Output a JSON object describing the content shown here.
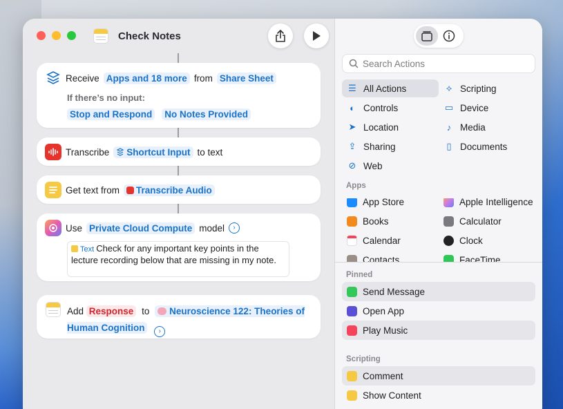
{
  "window": {
    "title": "Check Notes"
  },
  "editor": {
    "receive": {
      "verb": "Receive",
      "types": "Apps and 18 more",
      "from_word": "from",
      "source": "Share Sheet",
      "no_input_label": "If there’s no input:",
      "stop_token": "Stop and Respond",
      "no_notes_token": "No Notes Provided"
    },
    "transcribe": {
      "verb": "Transcribe",
      "input": "Shortcut Input",
      "suffix": "to text"
    },
    "get_text": {
      "verb": "Get text from",
      "input": "Transcribe Audio"
    },
    "use_model": {
      "verb": "Use",
      "model": "Private Cloud Compute",
      "suffix": "model",
      "text_tag": "Text",
      "prompt": "Check for any important key points in the lecture recording below that are missing in my note."
    },
    "add": {
      "verb": "Add",
      "item": "Response",
      "to_word": "to",
      "target": "Neuroscience 122: Theories of Human Cognition"
    }
  },
  "sidebar": {
    "search_placeholder": "Search Actions",
    "categories": [
      {
        "label": "All Actions",
        "icon": "list-icon"
      },
      {
        "label": "Scripting",
        "icon": "scripting-icon"
      },
      {
        "label": "Controls",
        "icon": "toggle-icon"
      },
      {
        "label": "Device",
        "icon": "device-icon"
      },
      {
        "label": "Location",
        "icon": "location-icon"
      },
      {
        "label": "Media",
        "icon": "music-note-icon"
      },
      {
        "label": "Sharing",
        "icon": "share-icon"
      },
      {
        "label": "Documents",
        "icon": "document-icon"
      },
      {
        "label": "Web",
        "icon": "compass-icon"
      }
    ],
    "apps_header": "Apps",
    "apps": [
      {
        "label": "App Store",
        "color": "#1a8cff"
      },
      {
        "label": "Apple Intelligence",
        "color": "#c67be8"
      },
      {
        "label": "Books",
        "color": "#f28a1e"
      },
      {
        "label": "Calculator",
        "color": "#7a7a7e"
      },
      {
        "label": "Calendar",
        "color": "#ffffff"
      },
      {
        "label": "Clock",
        "color": "#222222"
      },
      {
        "label": "Contacts",
        "color": "#9a8f86"
      },
      {
        "label": "FaceTime",
        "color": "#2fc755"
      }
    ],
    "pinned_header": "Pinned",
    "pinned": [
      {
        "label": "Send Message",
        "color": "#34c759"
      },
      {
        "label": "Open App",
        "color": "#5b4fd6"
      },
      {
        "label": "Play Music",
        "color": "#f5435b"
      }
    ],
    "scripting_header": "Scripting",
    "scripting": [
      {
        "label": "Comment",
        "color": "#f6c945"
      },
      {
        "label": "Show Content",
        "color": "#f6c945"
      }
    ]
  }
}
